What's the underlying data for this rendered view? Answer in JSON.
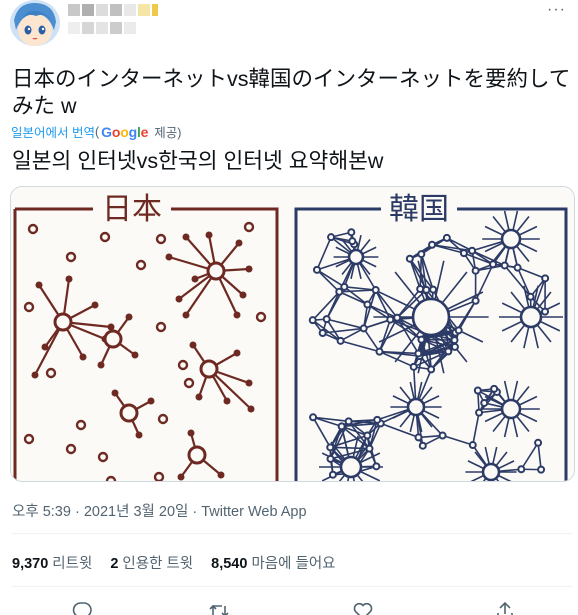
{
  "tweet": {
    "text": "日本のインターネットvs韓国のインターネットを要約してみた w",
    "translate_label": "일본어에서 번역",
    "translate_open_paren": "(",
    "translate_provider": "Google",
    "translate_provider_suffix": "제공)",
    "translated_text": "일본의 인터넷vs한국의 인터넷 요약해본w",
    "timestamp_line": "오후 5:39 · 2021년 3월 20일 · Twitter Web App"
  },
  "media": {
    "left_panel_title": "日本",
    "right_panel_title": "韓国"
  },
  "stats": {
    "retweets_count": "9,370",
    "retweets_label": "리트윗",
    "quotes_count": "2",
    "quotes_label": "인용한 트윗",
    "likes_count": "8,540",
    "likes_label": "마음에 들어요"
  },
  "icons": {
    "more": "more-options-icon",
    "reply": "reply-icon",
    "retweet": "retweet-icon",
    "like": "heart-icon",
    "share": "share-icon"
  },
  "colors": {
    "link": "#1d9bf0",
    "secondary_text": "#536471",
    "left_panel_ink": "#6e2a22",
    "right_panel_ink": "#2c3a66"
  }
}
